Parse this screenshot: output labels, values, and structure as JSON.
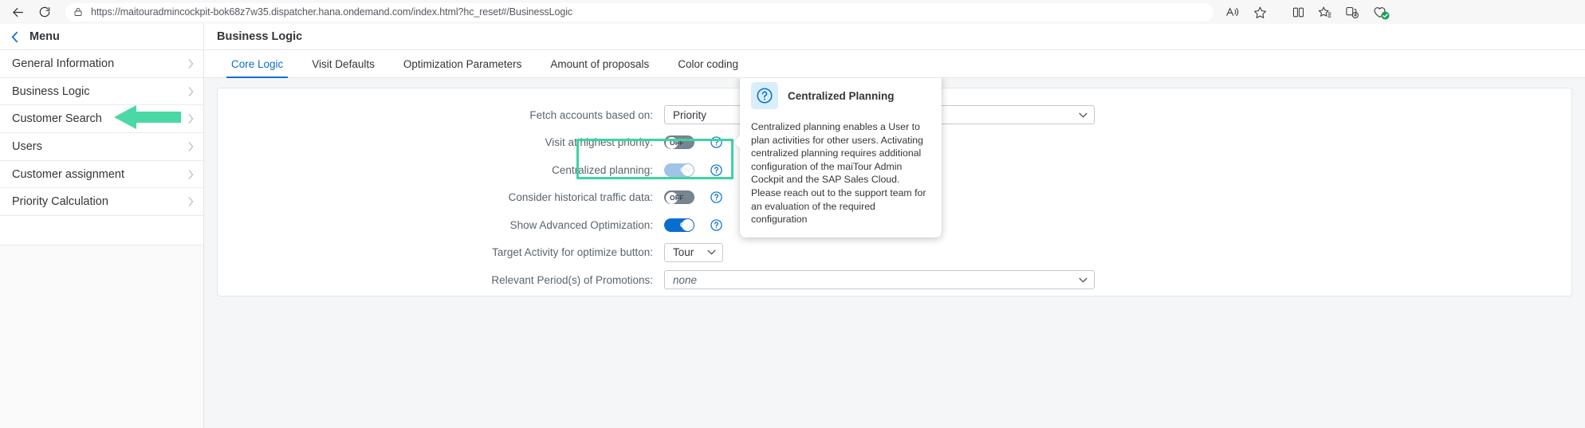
{
  "browser": {
    "back_title": "Back",
    "reload_title": "Refresh",
    "url_scheme": "https://",
    "url_host": "maitouradmincockpit-bok68z7w35.dispatcher.hana.ondemand.com",
    "url_path": "/index.html?hc_reset#/BusinessLogic",
    "url_full": "https://maitouradmincockpit-bok68z7w35.dispatcher.hana.ondemand.com/index.html?hc_reset#/BusinessLogic",
    "icons": {
      "lock": "lock-icon",
      "read_aloud": "read-aloud-icon",
      "favorite": "favorite-star-icon",
      "split_screen": "split-screen-icon",
      "collections": "collections-icon",
      "add_tab_group": "add-tab-group-icon",
      "extension": "extension-icon"
    }
  },
  "sidebar": {
    "title": "Menu",
    "back_icon": "chevron-left-icon",
    "items": [
      {
        "label": "General Information"
      },
      {
        "label": "Business Logic"
      },
      {
        "label": "Customer Search"
      },
      {
        "label": "Users"
      },
      {
        "label": "Customer assignment"
      },
      {
        "label": "Priority Calculation"
      }
    ]
  },
  "header": {
    "title": "Business Logic"
  },
  "tabs": [
    {
      "label": "Core Logic",
      "active": true
    },
    {
      "label": "Visit Defaults",
      "active": false
    },
    {
      "label": "Optimization Parameters",
      "active": false
    },
    {
      "label": "Amount of proposals",
      "active": false
    },
    {
      "label": "Color coding",
      "active": false
    }
  ],
  "form": {
    "fetch_accounts": {
      "label": "Fetch accounts based on:",
      "value": "Priority"
    },
    "visit_highest_priority": {
      "label": "Visit at highest priority:",
      "state": "OFF"
    },
    "centralized_planning": {
      "label": "Centralized planning:",
      "state": "ON"
    },
    "historical_traffic": {
      "label": "Consider historical traffic data:",
      "state": "OFF"
    },
    "show_advanced_optimization": {
      "label": "Show Advanced Optimization:",
      "state": "ON"
    },
    "target_activity": {
      "label": "Target Activity for optimize button:",
      "value": "Tour"
    },
    "relevant_periods": {
      "label": "Relevant Period(s) of Promotions:",
      "value": "none"
    }
  },
  "tooltip": {
    "title": "Centralized Planning",
    "body": "Centralized planning enables a User to plan activities for other users. Activating centralized planning requires additional configuration of the maiTour Admin Cockpit and the SAP Sales Cloud. Please reach out to the support team for an evaluation of the required configuration",
    "icon": "question-mark-circle-icon"
  },
  "annotations": {
    "highlight_color": "#3ed49f",
    "arrow_color": "#4ad8a5",
    "arrow_target": "Business Logic",
    "highlight_target": "Centralized planning"
  },
  "colors": {
    "accent": "#0a6ed1",
    "text": "#32363a",
    "muted": "#5a6570",
    "page_bg": "#f5f6f7"
  }
}
